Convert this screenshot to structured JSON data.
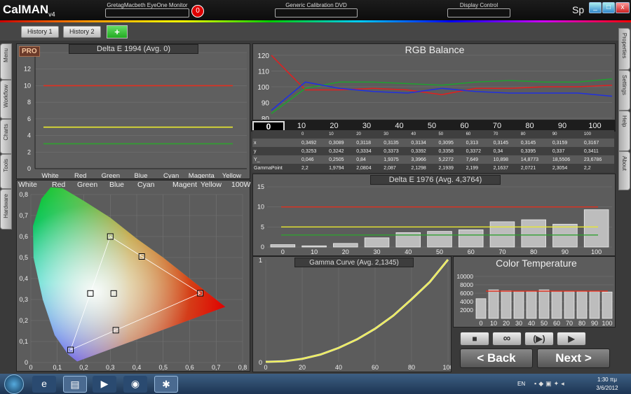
{
  "app": {
    "logo": "CalMAN",
    "logo_sub": "v4",
    "brand_right": "Sp"
  },
  "devices": [
    {
      "label": "GretagMacbeth EyeOne Monitor",
      "badge": "0"
    },
    {
      "label": "Generic Calibration DVD"
    },
    {
      "label": "Display Control"
    }
  ],
  "history": {
    "tab1": "History 1",
    "tab2": "History 2",
    "add": "+"
  },
  "left_tabs": [
    "Menu",
    "Workflow",
    "Charts",
    "Tools",
    "Hardware"
  ],
  "right_tabs": [
    "Properties",
    "Settings",
    "Help",
    "About"
  ],
  "deltaE94": {
    "title": "Delta E 1994 (Avg. 0)",
    "watermark": "PRO",
    "yticks": [
      "0",
      "2",
      "4",
      "6",
      "8",
      "10",
      "12",
      "14"
    ],
    "categories": [
      "White",
      "Red",
      "Green",
      "Blue",
      "Cyan",
      "Magenta",
      "Yellow"
    ],
    "ylim": [
      0,
      14
    ],
    "lines": [
      {
        "value": 10,
        "color": "#e03020"
      },
      {
        "value": 5,
        "color": "#e8e830"
      },
      {
        "value": 3,
        "color": "#30a030"
      }
    ]
  },
  "cie": {
    "header": [
      "White",
      "Red",
      "Green",
      "Blue",
      "Cyan",
      "Magent",
      "Yellow",
      "100W"
    ],
    "xticks": [
      "0",
      "0,1",
      "0,2",
      "0,3",
      "0,4",
      "0,5",
      "0,6",
      "0,7",
      "0,8"
    ],
    "yticks": [
      "0",
      "0,1",
      "0,2",
      "0,3",
      "0,4",
      "0,5",
      "0,6",
      "0,7",
      "0,8"
    ]
  },
  "rgb_balance": {
    "title": "RGB Balance",
    "yticks": [
      "80",
      "90",
      "100",
      "110",
      "120"
    ],
    "ylim": [
      80,
      120
    ],
    "series": [
      {
        "color": "#e02020",
        "values": [
          125,
          98,
          98,
          99,
          98,
          95,
          99,
          99,
          100,
          100,
          101
        ]
      },
      {
        "color": "#20a030",
        "values": [
          83,
          99,
          103,
          103,
          102,
          101,
          103,
          104,
          103,
          103,
          105
        ]
      },
      {
        "color": "#2030e0",
        "values": [
          85,
          103,
          99,
          97,
          96,
          99,
          97,
          96,
          96,
          96,
          94
        ]
      }
    ]
  },
  "ruler": {
    "selected": "0",
    "labels": [
      "10",
      "20",
      "30",
      "40",
      "50",
      "60",
      "70",
      "80",
      "90",
      "100"
    ],
    "sublabels": [
      "0",
      "10",
      "20",
      "30",
      "40",
      "50",
      "60",
      "70",
      "80",
      "90",
      "100"
    ]
  },
  "table": {
    "rows": [
      {
        "label": "x",
        "values": [
          "0,3492",
          "0,3089",
          "0,3118",
          "0,3135",
          "0,3134",
          "0,3095",
          "0,313",
          "0,3145",
          "0,3145",
          "0,3159",
          "0,3167"
        ]
      },
      {
        "label": "y",
        "values": [
          "0,3253",
          "0,3242",
          "0,3334",
          "0,3373",
          "0,3392",
          "0,3358",
          "0,3372",
          "0,34",
          "0,3395",
          "0,337",
          "0,3411"
        ]
      },
      {
        "label": "Y_",
        "values": [
          "0,046",
          "0,2505",
          "0,84",
          "1,9375",
          "3,3966",
          "5,2272",
          "7,649",
          "10,898",
          "14,8773",
          "18,5506",
          "23,6786"
        ]
      },
      {
        "label": "GammaPoint",
        "values": [
          "2,2",
          "1,9794",
          "2,0804",
          "2,087",
          "2,1298",
          "2,1939",
          "2,199",
          "2,1637",
          "2,0721",
          "2,3054",
          "2,2"
        ]
      }
    ]
  },
  "deltaE76": {
    "title": "Delta E 1976 (Avg. 4,3764)",
    "yticks": [
      "0",
      "5",
      "10",
      "15"
    ],
    "ylim": [
      0,
      15
    ],
    "categories": [
      "0",
      "10",
      "20",
      "30",
      "40",
      "50",
      "60",
      "70",
      "80",
      "90",
      "100"
    ],
    "values": [
      0.6,
      0.3,
      0.9,
      2.3,
      3.6,
      3.9,
      4.3,
      6.3,
      6.8,
      5.7,
      9.3
    ],
    "lines": [
      {
        "value": 10,
        "color": "#e03020"
      },
      {
        "value": 5,
        "color": "#e8e830"
      },
      {
        "value": 3,
        "color": "#30a030"
      }
    ]
  },
  "gamma": {
    "title": "Gamma Curve (Avg. 2,1345)",
    "xticks": [
      "0",
      "20",
      "40",
      "60",
      "80",
      "100"
    ],
    "yticks": [
      "0",
      "1"
    ],
    "x": [
      0,
      10,
      20,
      30,
      40,
      50,
      60,
      70,
      80,
      90,
      100
    ],
    "y": [
      0,
      0.0048,
      0.029,
      0.071,
      0.136,
      0.219,
      0.324,
      0.452,
      0.612,
      0.781,
      1.0
    ]
  },
  "ct": {
    "title": "Color Temperature",
    "yticks": [
      "2000",
      "4000",
      "6000",
      "8000",
      "10000"
    ],
    "ylim": [
      0,
      11000
    ],
    "categories": [
      "0",
      "10",
      "20",
      "30",
      "40",
      "50",
      "60",
      "70",
      "80",
      "90",
      "100"
    ],
    "values": [
      4700,
      6800,
      6600,
      6500,
      6400,
      6800,
      6500,
      6400,
      6400,
      6400,
      6300
    ],
    "target": 6500
  },
  "controls": {
    "stop": "■",
    "loop": "∞",
    "play_pause": "(▶)",
    "play": "▶",
    "back": "< Back",
    "next": "Next >"
  },
  "taskbar": {
    "lang": "EN",
    "time": "1:30 πμ",
    "date": "3/6/2012"
  }
}
